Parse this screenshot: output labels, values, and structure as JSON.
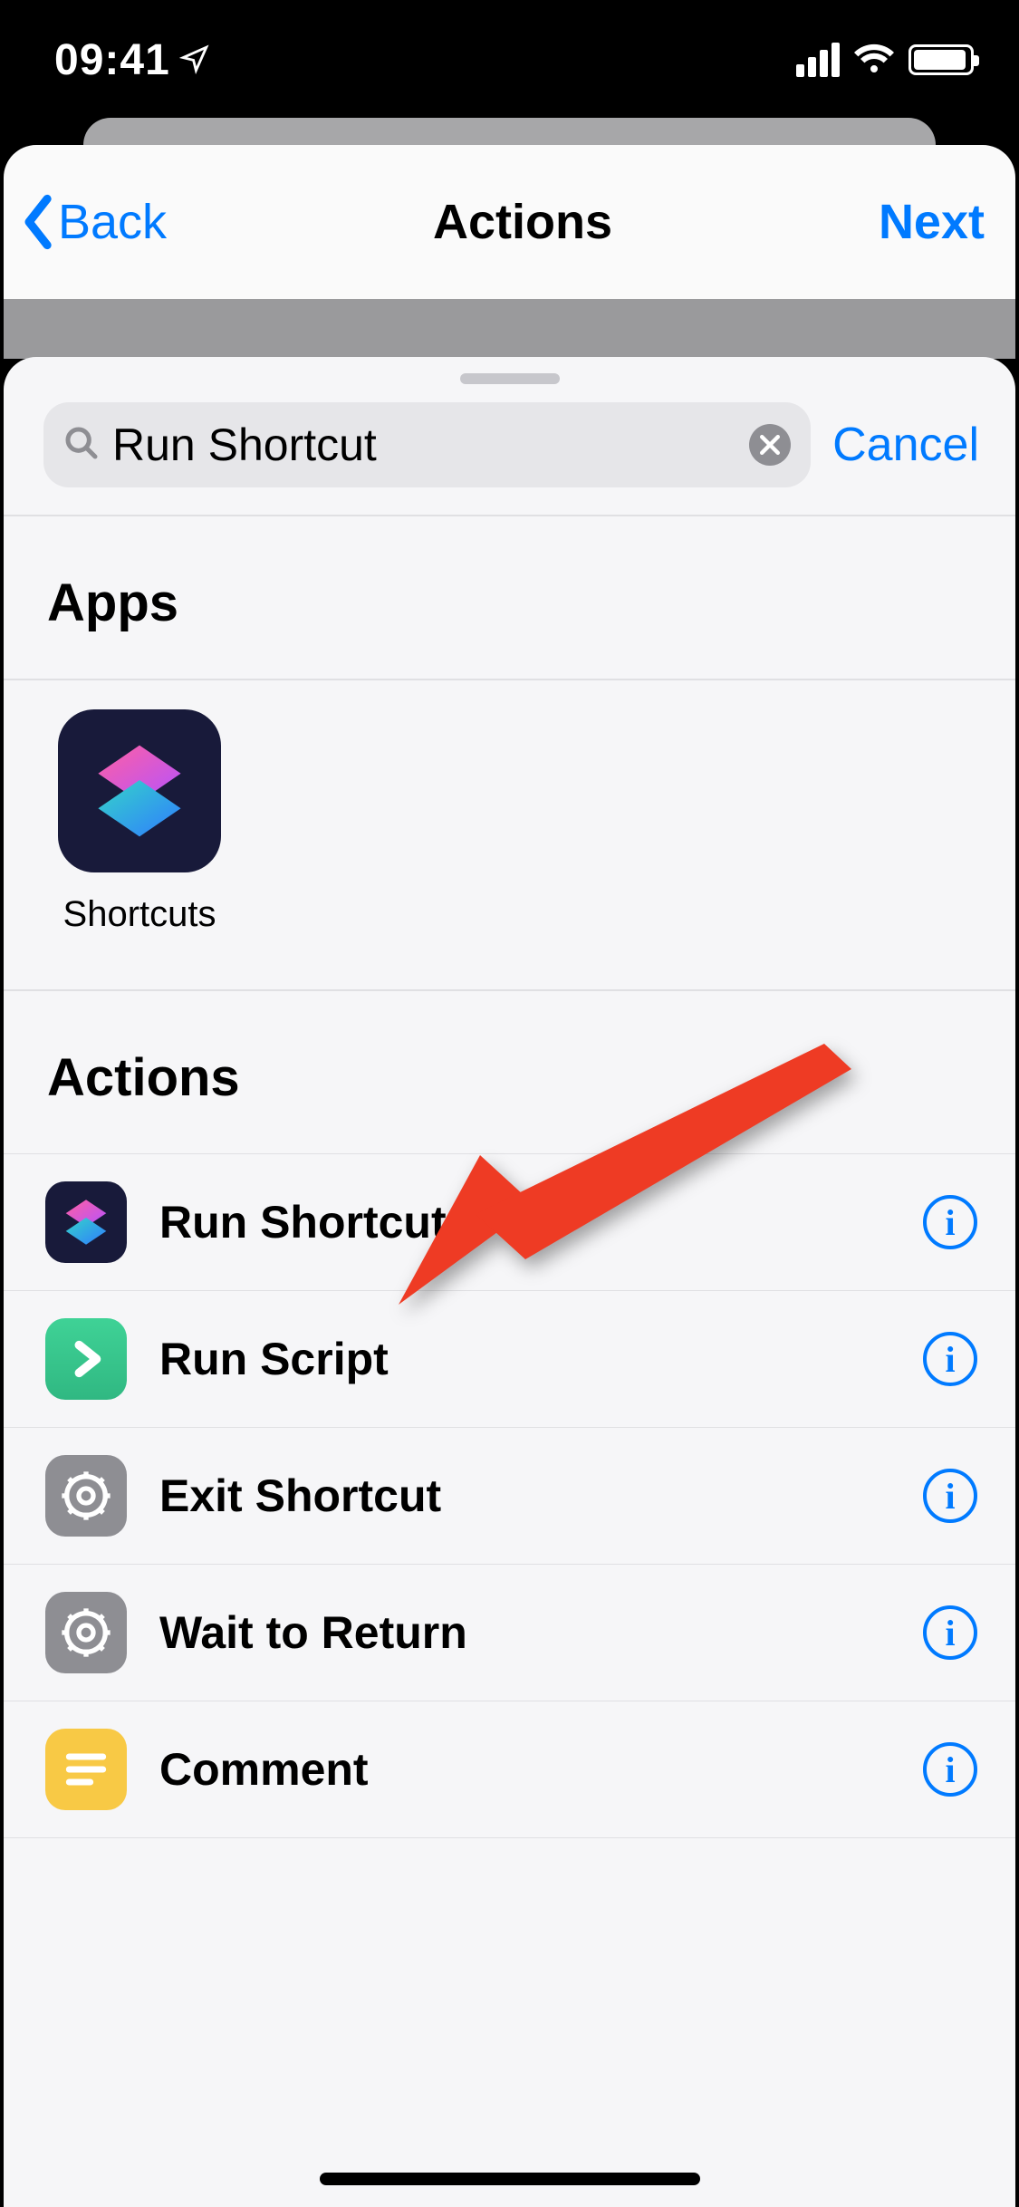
{
  "status": {
    "time": "09:41"
  },
  "nav": {
    "back": "Back",
    "title": "Actions",
    "next": "Next"
  },
  "search": {
    "value": "Run Shortcut",
    "cancel": "Cancel"
  },
  "sections": {
    "apps_title": "Apps",
    "actions_title": "Actions"
  },
  "apps": [
    {
      "label": "Shortcuts"
    }
  ],
  "actions": [
    {
      "label": "Run Shortcut",
      "icon": "shortcuts"
    },
    {
      "label": "Run Script",
      "icon": "green-chevron"
    },
    {
      "label": "Exit Shortcut",
      "icon": "gear"
    },
    {
      "label": "Wait to Return",
      "icon": "gear"
    },
    {
      "label": "Comment",
      "icon": "yellow-lines"
    }
  ]
}
